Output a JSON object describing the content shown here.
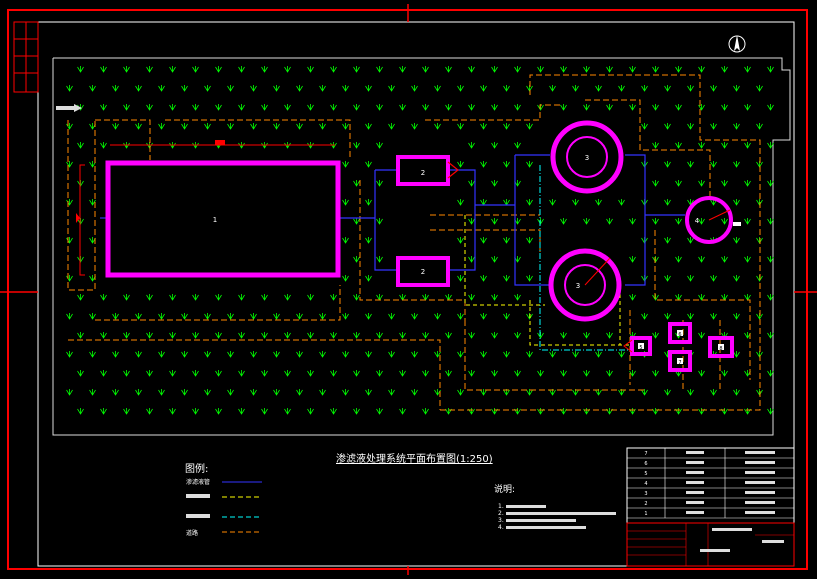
{
  "drawing": {
    "title": "渗滤液处理系统平面布置图(1:250)",
    "north_symbol": "north-arrow",
    "colors": {
      "background": "#000000",
      "frame_red": "#ff0000",
      "frame_white": "#ffffff",
      "tank_magenta": "#ff00ff",
      "pipe_blue": "#3333ff",
      "pipe_yellow": "#ffff00",
      "pipe_cyan": "#00ffff",
      "road_orange": "#ff8800",
      "grass_green": "#00ff00"
    },
    "structure_labels": [
      "1",
      "2",
      "2",
      "3",
      "3",
      "4",
      "5",
      "6",
      "7",
      "8"
    ]
  },
  "legend": {
    "heading": "图例:",
    "items": [
      {
        "label": "渗滤液管",
        "color": "#3333ff"
      },
      {
        "label": "",
        "color": "#ffff00"
      },
      {
        "label": "",
        "color": "#00ffff"
      },
      {
        "label": "道路",
        "color": "#ff8800"
      }
    ]
  },
  "notes": {
    "heading": "说明:",
    "items": [
      "1.",
      "2.",
      "3.",
      "4."
    ]
  },
  "title_block": {
    "row_numbers": [
      "7",
      "6",
      "5",
      "4",
      "3",
      "2",
      "1"
    ]
  }
}
